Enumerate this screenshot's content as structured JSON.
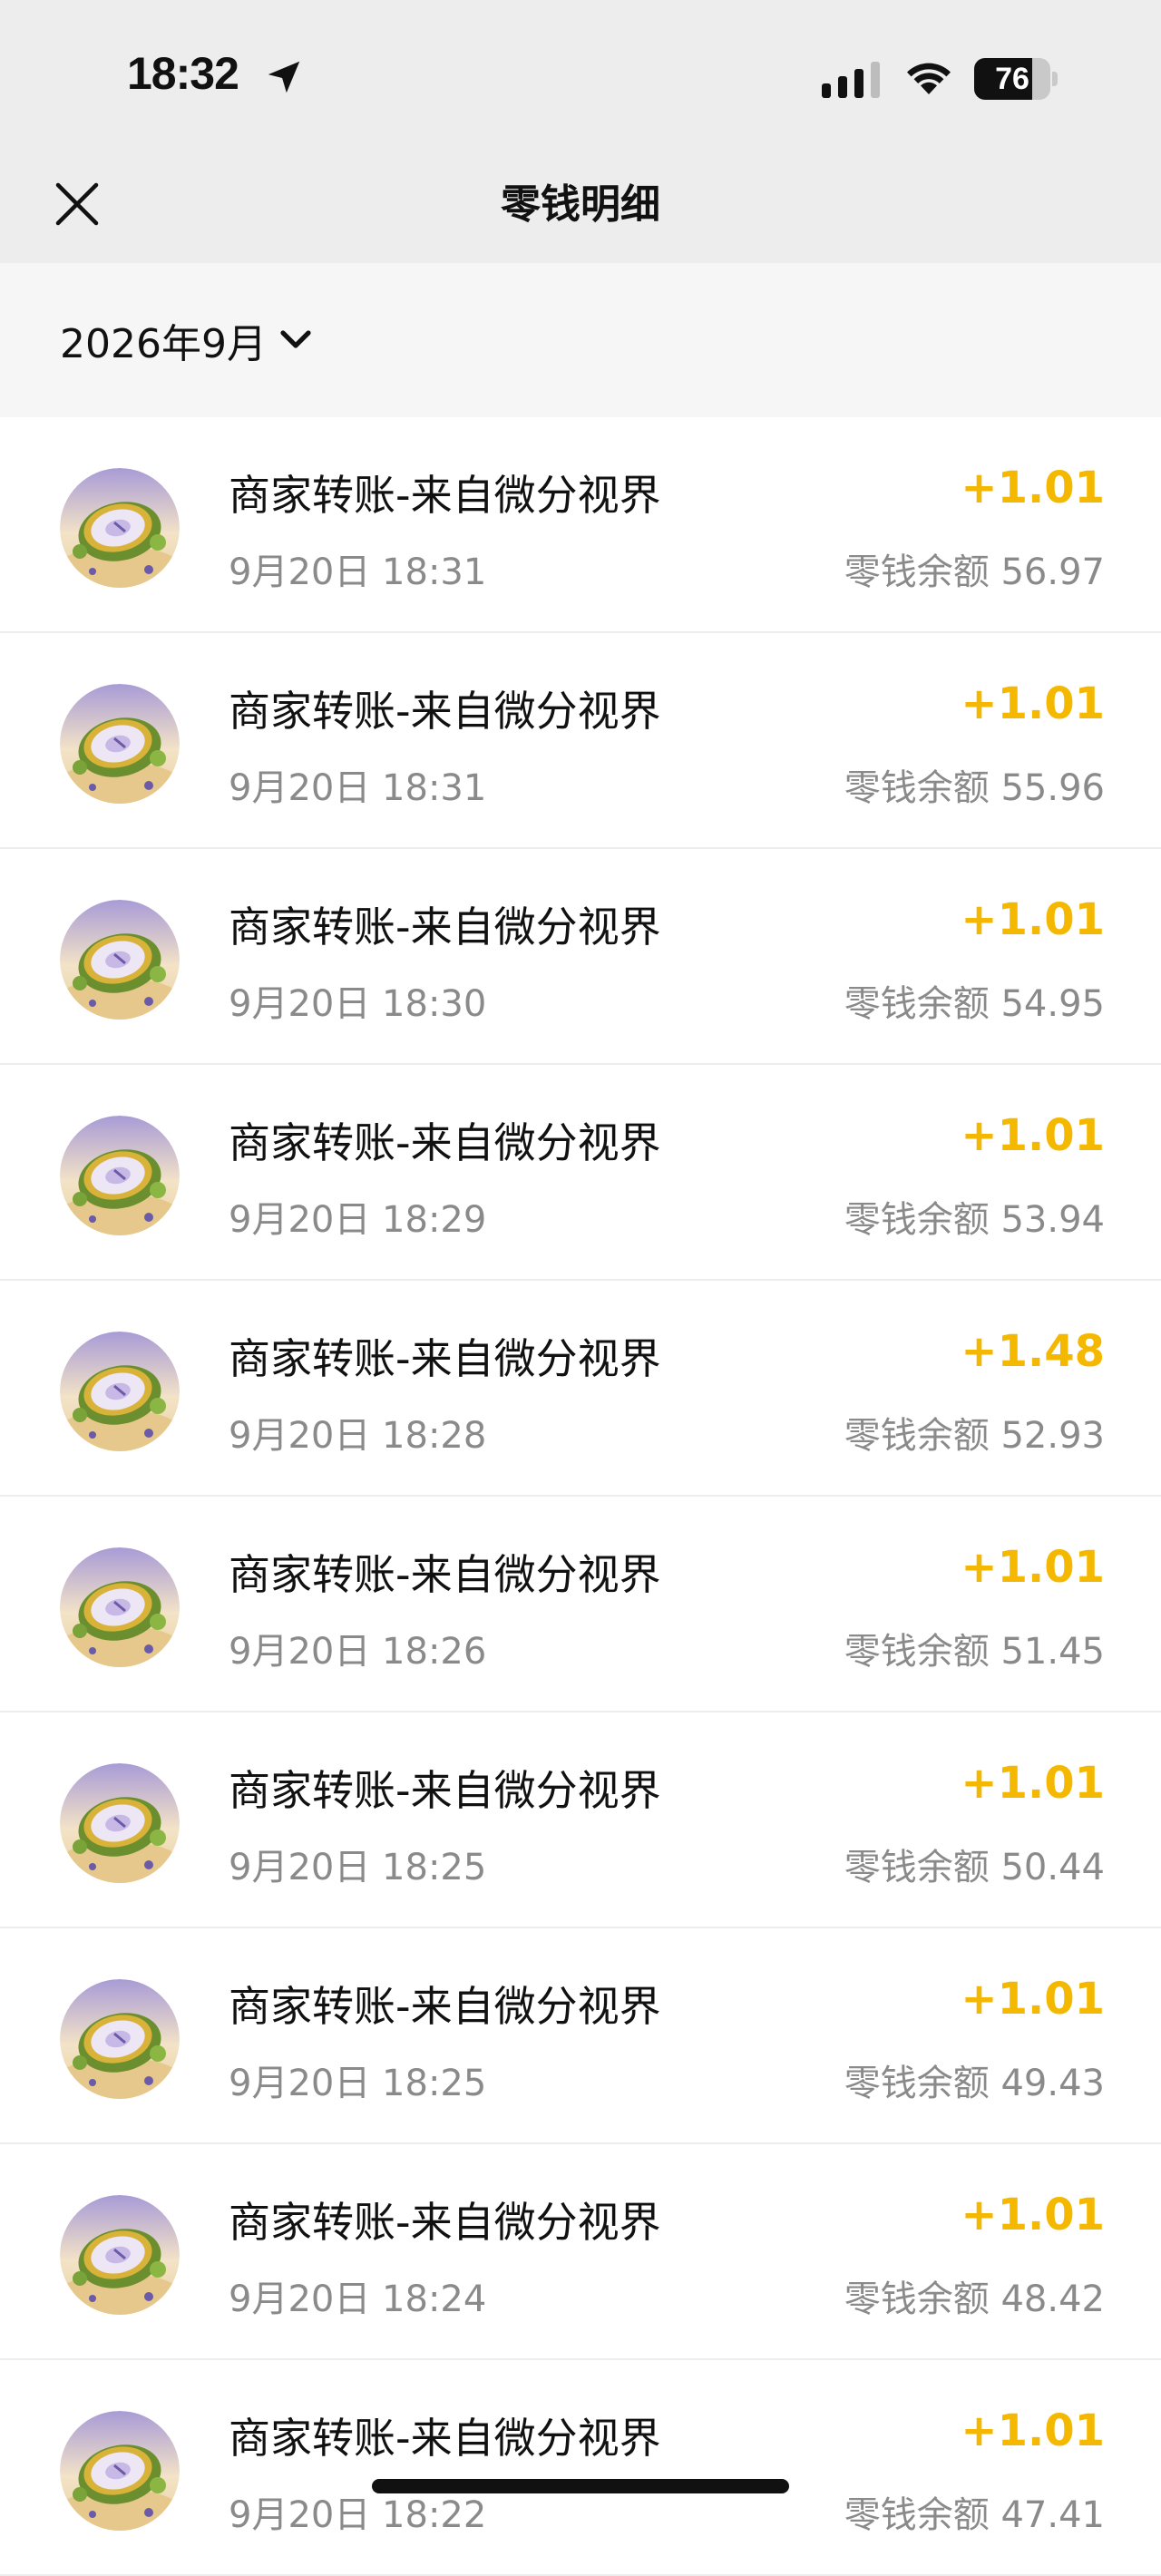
{
  "status_bar": {
    "time": "18:32",
    "battery_level": "76",
    "battery_fraction": 0.76,
    "icons": [
      "location-arrow-icon",
      "cellular-signal-icon",
      "wifi-icon",
      "battery-icon"
    ]
  },
  "nav": {
    "title": "零钱明细",
    "close_icon": "close-icon"
  },
  "filter": {
    "month": "2026年9月",
    "chevron_icon": "chevron-down-icon"
  },
  "colors": {
    "amount": "#f5b800",
    "secondary_text": "#8a8a8a",
    "header_bg": "#ededed"
  },
  "transactions": [
    {
      "title": "商家转账-来自微分视界",
      "time": "9月20日 18:31",
      "amount": "+1.01",
      "balance": "零钱余额 56.97"
    },
    {
      "title": "商家转账-来自微分视界",
      "time": "9月20日 18:31",
      "amount": "+1.01",
      "balance": "零钱余额 55.96"
    },
    {
      "title": "商家转账-来自微分视界",
      "time": "9月20日 18:30",
      "amount": "+1.01",
      "balance": "零钱余额 54.95"
    },
    {
      "title": "商家转账-来自微分视界",
      "time": "9月20日 18:29",
      "amount": "+1.01",
      "balance": "零钱余额 53.94"
    },
    {
      "title": "商家转账-来自微分视界",
      "time": "9月20日 18:28",
      "amount": "+1.48",
      "balance": "零钱余额 52.93"
    },
    {
      "title": "商家转账-来自微分视界",
      "time": "9月20日 18:26",
      "amount": "+1.01",
      "balance": "零钱余额 51.45"
    },
    {
      "title": "商家转账-来自微分视界",
      "time": "9月20日 18:25",
      "amount": "+1.01",
      "balance": "零钱余额 50.44"
    },
    {
      "title": "商家转账-来自微分视界",
      "time": "9月20日 18:25",
      "amount": "+1.01",
      "balance": "零钱余额 49.43"
    },
    {
      "title": "商家转账-来自微分视界",
      "time": "9月20日 18:24",
      "amount": "+1.01",
      "balance": "零钱余额 48.42"
    },
    {
      "title": "商家转账-来自微分视界",
      "time": "9月20日 18:22",
      "amount": "+1.01",
      "balance": "零钱余额 47.41"
    }
  ]
}
